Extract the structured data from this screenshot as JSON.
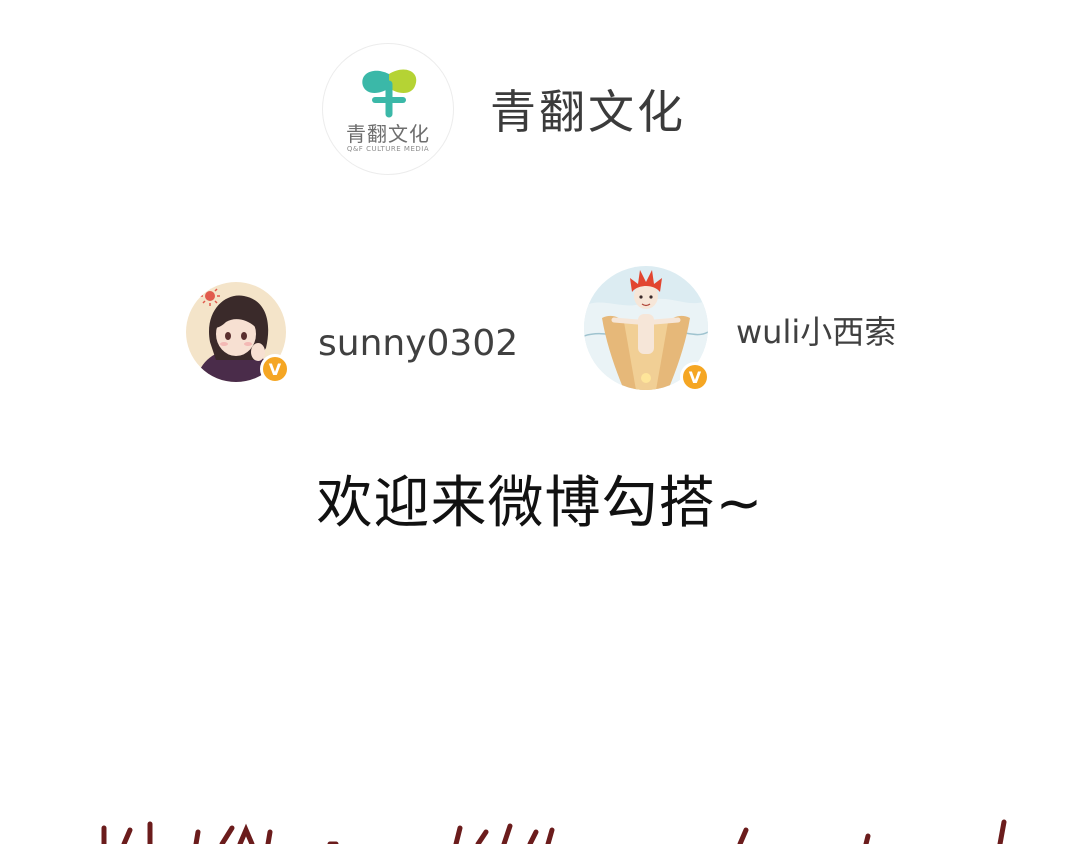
{
  "publisher": {
    "logo_name": "青翻文化",
    "logo_tagline": "Q&F CULTURE MEDIA",
    "name": "青翻文化",
    "logo_color": "#3bb8a8"
  },
  "authors": [
    {
      "name": "sunny0302",
      "verified": true,
      "badge_label": "V"
    },
    {
      "name": "wuli小西索",
      "verified": true,
      "badge_label": "V"
    }
  ],
  "welcome_text": "欢迎来微博勾搭~",
  "colors": {
    "badge": "#f5a623",
    "bottom_ink": "#6b1c1c"
  }
}
